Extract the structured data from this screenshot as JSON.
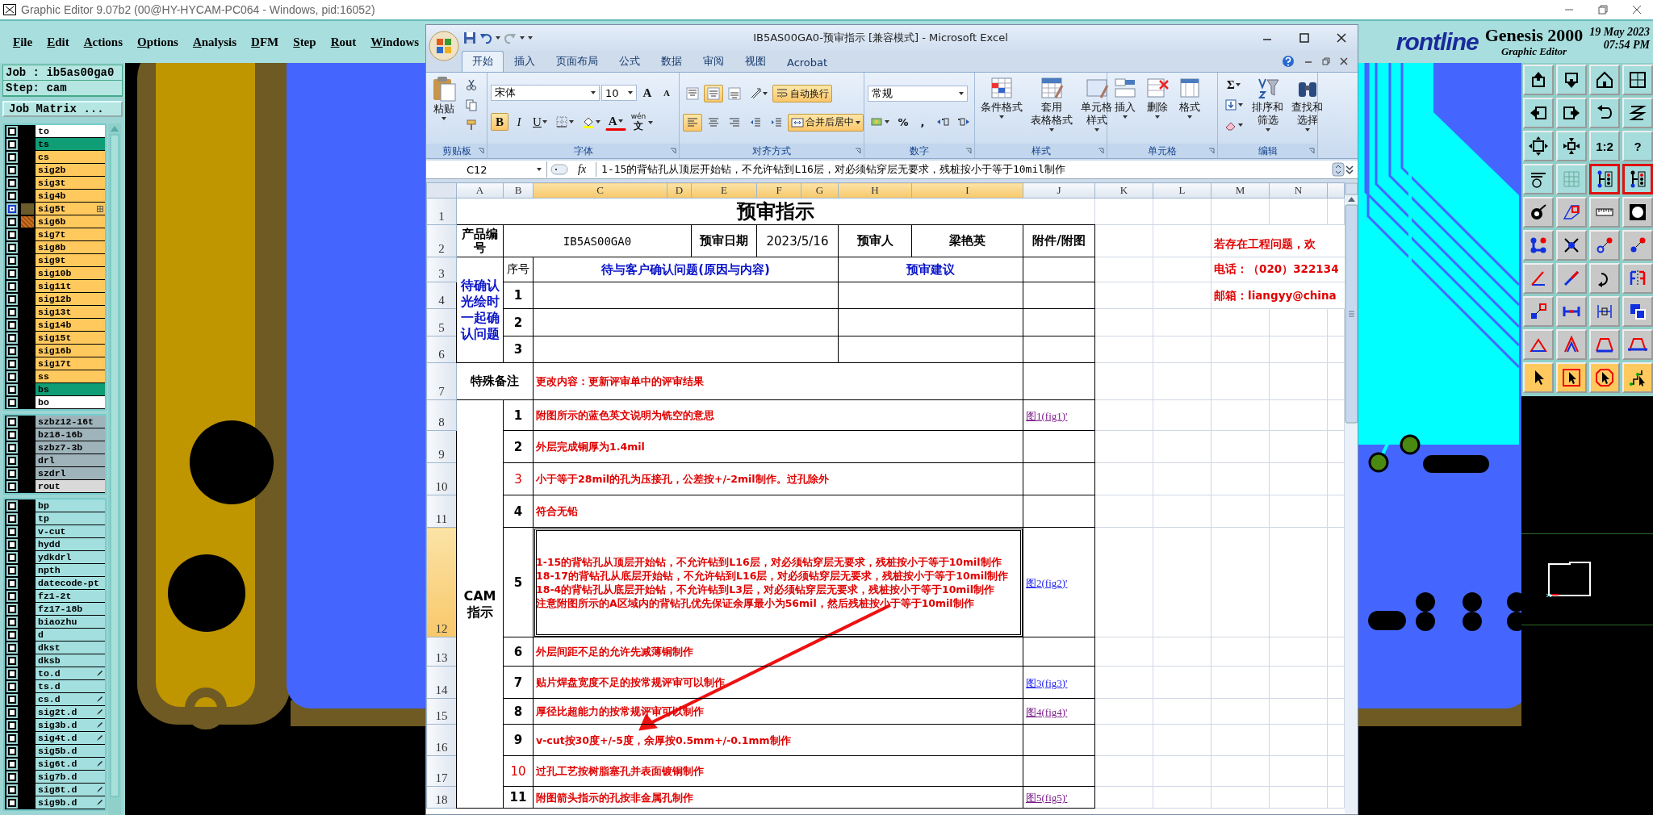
{
  "genesis": {
    "title": "Graphic Editor 9.07b2 (00@HY-HYCAM-PC064 - Windows, pid:16052)",
    "menu": [
      "File",
      "Edit",
      "Actions",
      "Options",
      "Analysis",
      "DFM",
      "Step",
      "Rout",
      "Windows"
    ],
    "logo": {
      "brand": "rontline",
      "product": "Genesis 2000",
      "subtitle": "Graphic Editor",
      "date": "19 May 2023",
      "time": "07:54 PM"
    },
    "job": "Job : ib5as00ga0",
    "step": "Step: cam",
    "job_matrix_button": "Job Matrix ...",
    "layer_groups": [
      [
        {
          "name": "to",
          "color": "#ffffff",
          "work": false,
          "displayed": false
        },
        {
          "name": "ts",
          "color": "#0f9d76",
          "work": false,
          "displayed": false
        },
        {
          "name": "cs",
          "color": "#ffc95e",
          "work": false,
          "displayed": false
        },
        {
          "name": "sig2b",
          "color": "#ffc95e",
          "work": false,
          "displayed": false
        },
        {
          "name": "sig3t",
          "color": "#ffc95e",
          "work": false,
          "displayed": false
        },
        {
          "name": "sig4b",
          "color": "#ffc95e",
          "work": false,
          "displayed": false
        },
        {
          "name": "sig5t",
          "color": "#ffc95e",
          "work": true,
          "displayed": false,
          "kind": "grid"
        },
        {
          "name": "sig6b",
          "color": "#ffc95e",
          "work": false,
          "displayed": true
        },
        {
          "name": "sig7t",
          "color": "#ffc95e",
          "work": false,
          "displayed": false
        },
        {
          "name": "sig8b",
          "color": "#ffc95e",
          "work": false,
          "displayed": false
        },
        {
          "name": "sig9t",
          "color": "#ffc95e",
          "work": false,
          "displayed": false
        },
        {
          "name": "sig10b",
          "color": "#ffc95e",
          "work": false,
          "displayed": false
        },
        {
          "name": "sig11t",
          "color": "#ffc95e",
          "work": false,
          "displayed": false
        },
        {
          "name": "sig12b",
          "color": "#ffc95e",
          "work": false,
          "displayed": false
        },
        {
          "name": "sig13t",
          "color": "#ffc95e",
          "work": false,
          "displayed": false
        },
        {
          "name": "sig14b",
          "color": "#ffc95e",
          "work": false,
          "displayed": false
        },
        {
          "name": "sig15t",
          "color": "#ffc95e",
          "work": false,
          "displayed": false
        },
        {
          "name": "sig16b",
          "color": "#ffc95e",
          "work": false,
          "displayed": false
        },
        {
          "name": "sig17t",
          "color": "#ffc95e",
          "work": false,
          "displayed": false
        },
        {
          "name": "ss",
          "color": "#ffc95e",
          "work": false,
          "displayed": false
        },
        {
          "name": "bs",
          "color": "#0f9d76",
          "work": false,
          "displayed": false
        },
        {
          "name": "bo",
          "color": "#ffffff",
          "work": false,
          "displayed": false
        }
      ],
      [
        {
          "name": "szbz12-16t",
          "color": "#9fb3ba",
          "work": false,
          "displayed": false
        },
        {
          "name": "bz18-16b",
          "color": "#9fb3ba",
          "work": false,
          "displayed": false
        },
        {
          "name": "szbz7-3b",
          "color": "#9fb3ba",
          "work": false,
          "displayed": false
        },
        {
          "name": "drl",
          "color": "#9fb3ba",
          "work": false,
          "displayed": false
        },
        {
          "name": "szdrl",
          "color": "#9fb3ba",
          "work": false,
          "displayed": false
        },
        {
          "name": "rout",
          "color": "#d9d9d9",
          "work": false,
          "displayed": false
        }
      ],
      [
        {
          "name": "bp",
          "color": "#a3dfdf",
          "work": false,
          "displayed": false
        },
        {
          "name": "tp",
          "color": "#a3dfdf",
          "work": false,
          "displayed": false
        },
        {
          "name": "v-cut",
          "color": "#a3dfdf",
          "work": false,
          "displayed": false
        },
        {
          "name": "hydd",
          "color": "#a3dfdf",
          "work": false,
          "displayed": false
        },
        {
          "name": "ydkdrl",
          "color": "#a3dfdf",
          "work": false,
          "displayed": false
        },
        {
          "name": "npth",
          "color": "#a3dfdf",
          "work": false,
          "displayed": false
        },
        {
          "name": "datecode-pt",
          "color": "#a3dfdf",
          "work": false,
          "displayed": false
        },
        {
          "name": "fz1-2t",
          "color": "#a3dfdf",
          "work": false,
          "displayed": false
        },
        {
          "name": "fz17-18b",
          "color": "#a3dfdf",
          "work": false,
          "displayed": false
        },
        {
          "name": "biaozhu",
          "color": "#a3dfdf",
          "work": false,
          "displayed": false
        },
        {
          "name": "d",
          "color": "#a3dfdf",
          "work": false,
          "displayed": false
        },
        {
          "name": "dkst",
          "color": "#a3dfdf",
          "work": false,
          "displayed": false
        },
        {
          "name": "dksb",
          "color": "#a3dfdf",
          "work": false,
          "displayed": false
        },
        {
          "name": "to.d",
          "color": "#a3dfdf",
          "work": false,
          "displayed": false,
          "kind": "pen"
        },
        {
          "name": "ts.d",
          "color": "#a3dfdf",
          "work": false,
          "displayed": false
        },
        {
          "name": "cs.d",
          "color": "#a3dfdf",
          "work": false,
          "displayed": false,
          "kind": "pen"
        },
        {
          "name": "sig2t.d",
          "color": "#a3dfdf",
          "work": false,
          "displayed": false,
          "kind": "pen"
        },
        {
          "name": "sig3b.d",
          "color": "#a3dfdf",
          "work": false,
          "displayed": false,
          "kind": "pen"
        },
        {
          "name": "sig4t.d",
          "color": "#a3dfdf",
          "work": false,
          "displayed": false,
          "kind": "pen"
        },
        {
          "name": "sig5b.d",
          "color": "#a3dfdf",
          "work": false,
          "displayed": false
        },
        {
          "name": "sig6t.d",
          "color": "#a3dfdf",
          "work": false,
          "displayed": false,
          "kind": "pen"
        },
        {
          "name": "sig7b.d",
          "color": "#a3dfdf",
          "work": false,
          "displayed": false
        },
        {
          "name": "sig8t.d",
          "color": "#a3dfdf",
          "work": false,
          "displayed": false,
          "kind": "pen"
        },
        {
          "name": "sig9b.d",
          "color": "#a3dfdf",
          "work": false,
          "displayed": false,
          "kind": "pen"
        }
      ]
    ],
    "tool_buttons": [
      {
        "kind": "view",
        "active": false
      },
      {
        "kind": "view",
        "active": false
      },
      {
        "kind": "view",
        "active": false
      },
      {
        "kind": "view",
        "active": false
      },
      {
        "kind": "view",
        "active": false
      },
      {
        "kind": "view",
        "active": false
      },
      {
        "kind": "view",
        "active": false
      },
      {
        "kind": "view",
        "active": false
      },
      {
        "kind": "view",
        "active": false
      },
      {
        "kind": "view",
        "active": false
      },
      {
        "kind": "view",
        "active": false,
        "label": "1:2"
      },
      {
        "kind": "view",
        "active": false,
        "label": "?"
      },
      {
        "kind": "view",
        "active": false
      },
      {
        "kind": "view",
        "active": false
      },
      {
        "kind": "view",
        "active": true
      },
      {
        "kind": "view",
        "active": true
      },
      {
        "kind": "edit",
        "active": false
      },
      {
        "kind": "edit",
        "active": false
      },
      {
        "kind": "edit",
        "active": false
      },
      {
        "kind": "edit",
        "active": false
      },
      {
        "kind": "edit",
        "active": false
      },
      {
        "kind": "edit",
        "active": false
      },
      {
        "kind": "edit",
        "active": false
      },
      {
        "kind": "edit",
        "active": false
      },
      {
        "kind": "edit",
        "active": false
      },
      {
        "kind": "edit",
        "active": false
      },
      {
        "kind": "edit",
        "active": false
      },
      {
        "kind": "edit",
        "active": false
      },
      {
        "kind": "edit",
        "active": false
      },
      {
        "kind": "edit",
        "active": false
      },
      {
        "kind": "edit",
        "active": false
      },
      {
        "kind": "edit",
        "active": false
      },
      {
        "kind": "edit",
        "active": false
      },
      {
        "kind": "edit",
        "active": false
      },
      {
        "kind": "edit",
        "active": false
      },
      {
        "kind": "edit",
        "active": false
      },
      {
        "kind": "select",
        "active": false
      },
      {
        "kind": "select",
        "active": false
      },
      {
        "kind": "select",
        "active": false
      },
      {
        "kind": "select",
        "active": false
      }
    ]
  },
  "excel": {
    "title": "IB5AS00GA0-预审指示  [兼容模式] - Microsoft Excel",
    "tabs": [
      {
        "label": "开始",
        "selected": true
      },
      {
        "label": "插入",
        "selected": false
      },
      {
        "label": "页面布局",
        "selected": false
      },
      {
        "label": "公式",
        "selected": false
      },
      {
        "label": "数据",
        "selected": false
      },
      {
        "label": "审阅",
        "selected": false
      },
      {
        "label": "视图",
        "selected": false
      },
      {
        "label": "Acrobat",
        "selected": false
      }
    ],
    "clipboard": {
      "label": "剪贴板",
      "paste": "粘贴"
    },
    "font": {
      "label": "字体",
      "name": "宋体",
      "size": "10",
      "grow": "A",
      "shrink": "A",
      "bold": {
        "text": "B",
        "on": true
      },
      "italic": {
        "text": "I",
        "on": false
      },
      "underline": {
        "text": "U",
        "on": false
      },
      "color_letter": "A",
      "phonetic": "wén",
      "phonetic_char": "文"
    },
    "alignment": {
      "label": "对齐方式",
      "vertical": [
        {
          "on": false
        },
        {
          "on": true
        },
        {
          "on": false
        }
      ],
      "horizontal": [
        {
          "on": true
        },
        {
          "on": false
        },
        {
          "on": false
        }
      ],
      "wrap": {
        "text": "自动换行",
        "on": true
      },
      "merge": {
        "text": "合并后居中",
        "on": true
      }
    },
    "number": {
      "label": "数字",
      "format": "常规",
      "percent": "%",
      "comma": ","
    },
    "styles": {
      "label": "样式",
      "buttons": [
        [
          "条件格式"
        ],
        [
          "套用",
          "表格格式"
        ],
        [
          "单元格",
          "样式"
        ]
      ]
    },
    "cells": {
      "label": "单元格",
      "buttons": [
        "插入",
        "删除",
        "格式"
      ]
    },
    "editing": {
      "label": "编辑",
      "sum": "Σ",
      "buttons": [
        [
          "排序和",
          "筛选"
        ],
        [
          "查找和",
          "选择"
        ]
      ]
    },
    "formula_bar": {
      "name_box": "C12",
      "fx": "fx",
      "formula": "1-15的背钻孔从顶层开始钻，不允许钻到L16层，对必须钻穿层无要求，残桩按小于等于10mil制作"
    },
    "sheet": {
      "columns": [
        {
          "label": "A",
          "selected": false
        },
        {
          "label": "B",
          "selected": false
        },
        {
          "label": "C",
          "selected": true
        },
        {
          "label": "D",
          "selected": true
        },
        {
          "label": "E",
          "selected": true
        },
        {
          "label": "F",
          "selected": true
        },
        {
          "label": "G",
          "selected": true
        },
        {
          "label": "H",
          "selected": true
        },
        {
          "label": "I",
          "selected": true
        },
        {
          "label": "J",
          "selected": false
        },
        {
          "label": "K",
          "selected": false
        },
        {
          "label": "L",
          "selected": false
        },
        {
          "label": "M",
          "selected": false
        },
        {
          "label": "N",
          "selected": false
        }
      ],
      "rows": [
        {
          "label": "1",
          "selected": false
        },
        {
          "label": "2",
          "selected": false
        },
        {
          "label": "3",
          "selected": false
        },
        {
          "label": "4",
          "selected": false
        },
        {
          "label": "5",
          "selected": false
        },
        {
          "label": "6",
          "selected": false
        },
        {
          "label": "7",
          "selected": false
        },
        {
          "label": "8",
          "selected": false
        },
        {
          "label": "9",
          "selected": false
        },
        {
          "label": "10",
          "selected": false
        },
        {
          "label": "11",
          "selected": false
        },
        {
          "label": "12",
          "selected": true
        },
        {
          "label": "13",
          "selected": false
        },
        {
          "label": "14",
          "selected": false
        },
        {
          "label": "15",
          "selected": false
        },
        {
          "label": "16",
          "selected": false
        },
        {
          "label": "17",
          "selected": false
        },
        {
          "label": "18",
          "selected": false
        }
      ],
      "title": "预审指示",
      "header": {
        "product_label": "产品编号",
        "product_value": "IB5AS00GA0",
        "date_label": "预审日期",
        "date_value": "2023/5/16",
        "reviewer_label": "预审人",
        "reviewer_value": "梁艳英",
        "attachment_label": "附件/附图"
      },
      "pending": {
        "group_label": "待确认光绘时一起确认问题",
        "seq_label": "序号",
        "issue_label": "待与客户确认问题(原因与内容)",
        "suggestion_label": "预审建议",
        "numbers": [
          "1",
          "2",
          "3"
        ]
      },
      "special_note": {
        "label": "特殊备注",
        "text": "更改内容：更新评审单中的评审结果"
      },
      "cam": {
        "label": "CAM指示",
        "items": [
          {
            "number": "1",
            "flagged": false,
            "selected": false,
            "lines": [
              "附图所示的蓝色英文说明为铣空的意思"
            ],
            "attachment": {
              "text": "图1(fig1)'",
              "visited": true
            }
          },
          {
            "number": "2",
            "flagged": false,
            "selected": false,
            "lines": [
              "外层完成铜厚为1.4mil"
            ]
          },
          {
            "number": "3",
            "flagged": true,
            "selected": false,
            "lines": [
              "小于等于28mil的孔为压接孔，公差按+/-2mil制作。过孔除外"
            ]
          },
          {
            "number": "4",
            "flagged": false,
            "selected": false,
            "lines": [
              "符合无铅"
            ]
          },
          {
            "number": "5",
            "flagged": false,
            "selected": true,
            "lines": [
              "1-15的背钻孔从顶层开始钻，不允许钻到L16层，对必须钻穿层无要求，残桩按小于等于10mil制作",
              "18-17的背钻孔从底层开始钻，不允许钻到L16层，对必须钻穿层无要求，残桩按小于等于10mil制作",
              "18-4的背钻孔从底层开始钻，不允许钻到L3层，对必须钻穿层无要求，残桩按小于等于10mil制作",
              "注意附图所示的A区域内的背钻孔优先保证余厚最小为56mil，然后残桩按小于等于10mil制作"
            ],
            "attachment": {
              "text": "图2(fig2)'",
              "visited": false
            }
          },
          {
            "number": "6",
            "flagged": false,
            "selected": false,
            "lines": [
              "外层间距不足的允许先减薄铜制作"
            ]
          },
          {
            "number": "7",
            "flagged": false,
            "selected": false,
            "lines": [
              "贴片焊盘宽度不足的按常规评审可以制作"
            ],
            "attachment": {
              "text": "图3(fig3)'",
              "visited": false
            }
          },
          {
            "number": "8",
            "flagged": false,
            "selected": false,
            "lines": [
              "厚径比超能力的按常规评审可以制作"
            ],
            "attachment": {
              "text": "图4(fig4)'",
              "visited": true
            }
          },
          {
            "number": "9",
            "flagged": false,
            "selected": false,
            "lines": [
              "v-cut按30度+/-5度，余厚按0.5mm+/-0.1mm制作"
            ]
          },
          {
            "number": "10",
            "flagged": true,
            "selected": false,
            "lines": [
              "过孔工艺按树脂塞孔并表面镀铜制作"
            ]
          },
          {
            "number": "11",
            "flagged": false,
            "selected": false,
            "lines": [
              "附图箭头指示的孔按非金属孔制作"
            ],
            "attachment": {
              "text": "图5(fig5)'",
              "visited": true
            }
          }
        ]
      },
      "side_notes": [
        "若存在工程问题，欢",
        "电话：（020）322134",
        "邮箱：liangyy@china"
      ]
    }
  }
}
